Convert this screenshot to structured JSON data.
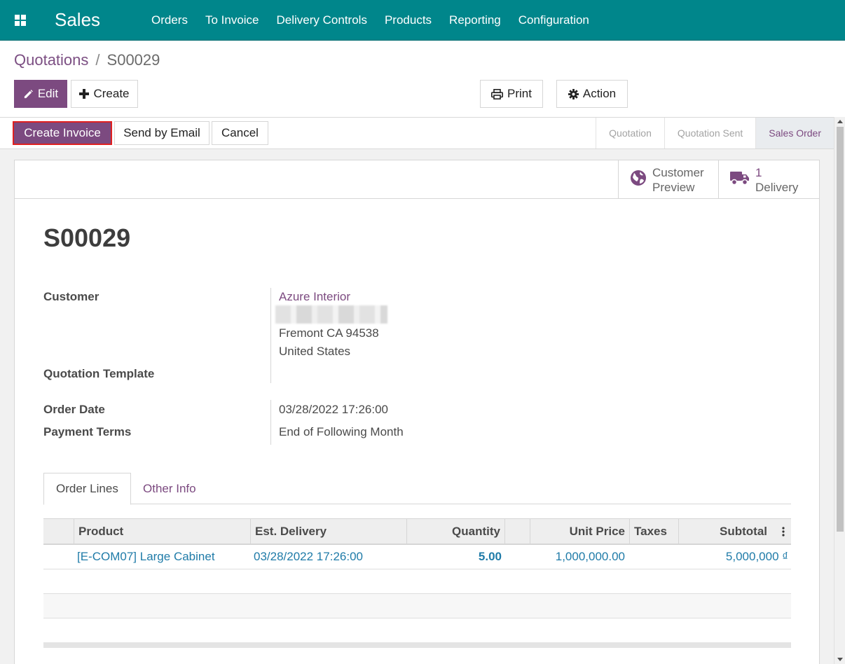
{
  "navbar": {
    "app_name": "Sales",
    "menu": [
      "Orders",
      "To Invoice",
      "Delivery Controls",
      "Products",
      "Reporting",
      "Configuration"
    ]
  },
  "breadcrumb": {
    "parent": "Quotations",
    "separator": "/",
    "current": "S00029"
  },
  "toolbar": {
    "edit": "Edit",
    "create": "Create",
    "print": "Print",
    "action": "Action"
  },
  "header_buttons": {
    "create_invoice": "Create Invoice",
    "send_email": "Send by Email",
    "cancel": "Cancel"
  },
  "stages": [
    "Quotation",
    "Quotation Sent",
    "Sales Order"
  ],
  "active_stage": "Sales Order",
  "smart_buttons": {
    "customer_preview": {
      "line1": "Customer",
      "line2": "Preview"
    },
    "delivery": {
      "count": "1",
      "label": "Delivery"
    }
  },
  "order": {
    "name": "S00029",
    "fields": {
      "customer_label": "Customer",
      "customer_name": "Azure Interior",
      "customer_city": "Fremont CA 94538",
      "customer_country": "United States",
      "template_label": "Quotation Template",
      "order_date_label": "Order Date",
      "order_date": "03/28/2022 17:26:00",
      "payment_terms_label": "Payment Terms",
      "payment_terms": "End of Following Month"
    }
  },
  "tabs": {
    "order_lines": "Order Lines",
    "other_info": "Other Info"
  },
  "table": {
    "headers": {
      "product": "Product",
      "delivery": "Est. Delivery",
      "quantity": "Quantity",
      "unit_price": "Unit Price",
      "taxes": "Taxes",
      "subtotal": "Subtotal"
    },
    "rows": [
      {
        "product": "[E-COM07] Large Cabinet",
        "delivery": "03/28/2022 17:26:00",
        "quantity": "5.00",
        "unit_price": "1,000,000.00",
        "taxes": "",
        "subtotal": "5,000,000 ₫"
      }
    ]
  },
  "colors": {
    "navbar": "#00868b",
    "primary": "#7c4a80",
    "link": "#1f7ba8",
    "highlight_border": "#e02020"
  }
}
